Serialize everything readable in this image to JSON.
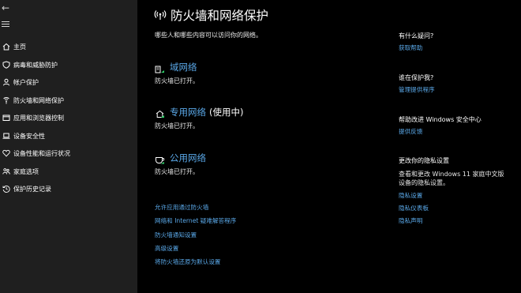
{
  "sidebar": {
    "back_glyph": "←",
    "items": [
      {
        "label": "主页",
        "icon": "home-icon"
      },
      {
        "label": "病毒和威胁防护",
        "icon": "shield-icon"
      },
      {
        "label": "帐户保护",
        "icon": "person-icon"
      },
      {
        "label": "防火墙和网络保护",
        "icon": "wifi-icon"
      },
      {
        "label": "应用和浏览器控制",
        "icon": "app-window-icon"
      },
      {
        "label": "设备安全性",
        "icon": "laptop-icon"
      },
      {
        "label": "设备性能和运行状况",
        "icon": "heart-icon"
      },
      {
        "label": "家庭选项",
        "icon": "family-icon"
      },
      {
        "label": "保护历史记录",
        "icon": "history-icon"
      }
    ]
  },
  "main": {
    "title": "防火墙和网络保护",
    "subtitle": "哪些人和哪些内容可以访问你的网络。",
    "networks": [
      {
        "name": "域网络",
        "in_use": "",
        "status": "防火墙已打开。",
        "icon": "domain-network-icon"
      },
      {
        "name": "专用网络",
        "in_use": "(使用中)",
        "status": "防火墙已打开。",
        "icon": "private-network-icon"
      },
      {
        "name": "公用网络",
        "in_use": "",
        "status": "防火墙已打开。",
        "icon": "public-network-icon"
      }
    ],
    "links": [
      "允许应用通过防火墙",
      "网络和 Internet 疑难解答程序",
      "防火墙通知设置",
      "高级设置",
      "将防火墙还原为默认设置"
    ]
  },
  "right": {
    "question": {
      "heading": "有什么疑问?",
      "link": "获取帮助"
    },
    "protect": {
      "heading": "谁在保护我?",
      "link": "管理提供程序"
    },
    "improve": {
      "heading": "帮助改进 Windows 安全中心",
      "link": "提供反馈"
    },
    "privacy": {
      "heading": "更改你的隐私设置",
      "text_line1": "查看和更改 Windows 11 家庭中文版",
      "text_line2": "设备的隐私设置。",
      "links": [
        "隐私设置",
        "隐私仪表板",
        "隐私声明"
      ]
    }
  },
  "colors": {
    "accent_link": "#5aa8e8",
    "sidebar_bg": "#1f1f1f",
    "main_bg": "#000000"
  }
}
